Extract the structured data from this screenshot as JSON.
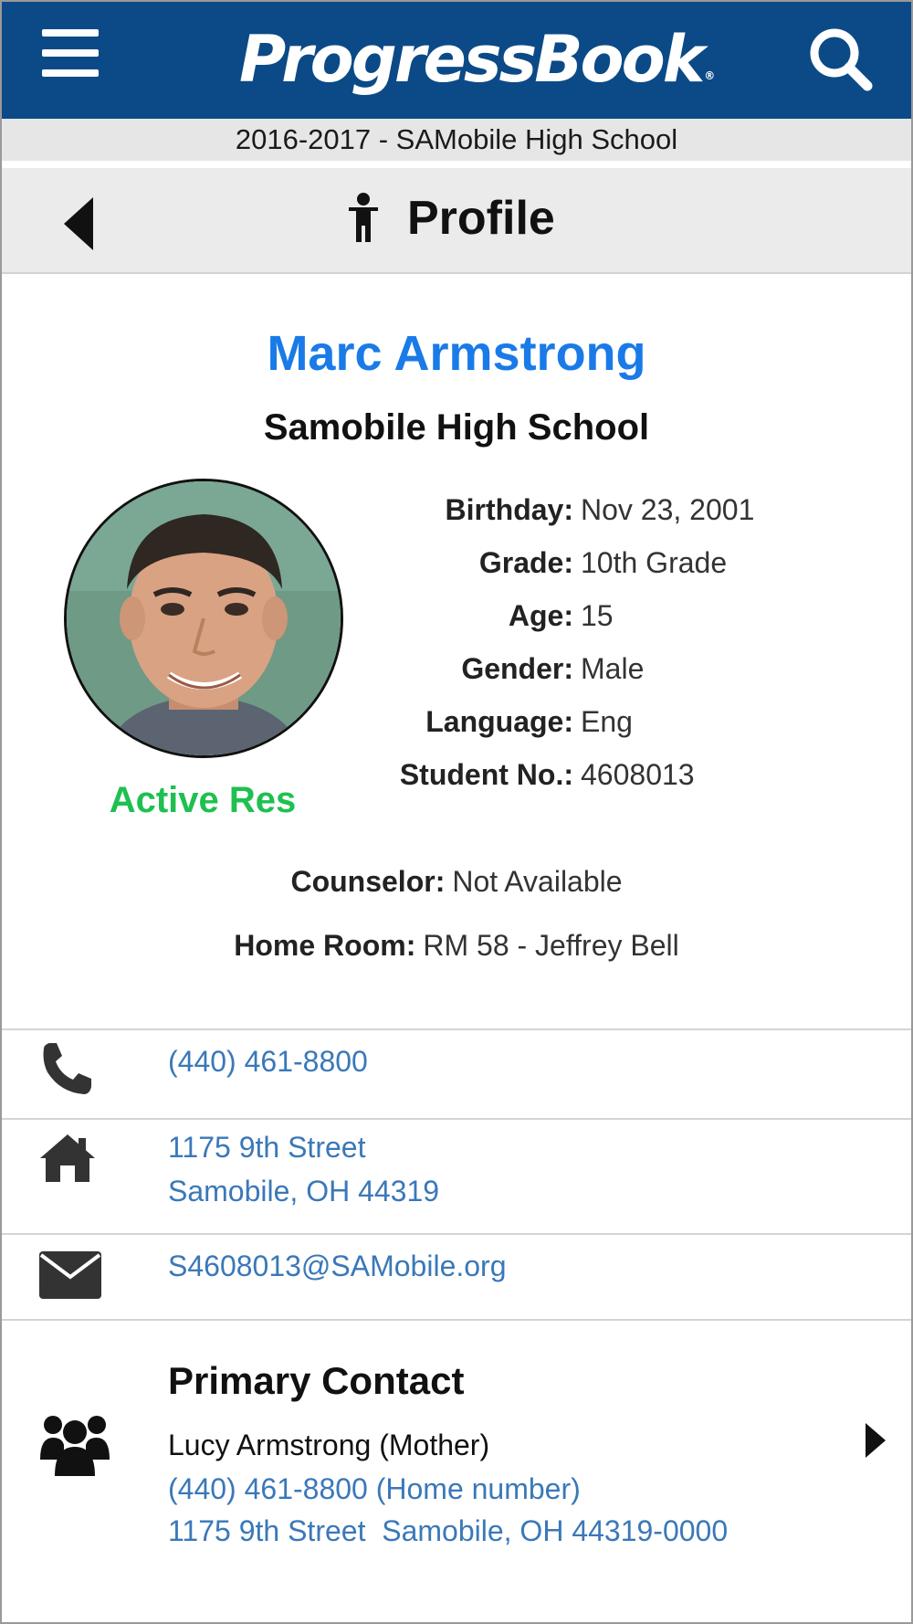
{
  "app": {
    "brand": "ProgressBook",
    "brand_mark": "®",
    "school_year": "2016-2017 - SAMobile High School",
    "page_title": "Profile"
  },
  "icons": {
    "menu": "hamburger-menu-icon",
    "search": "search-icon",
    "back": "back-arrow-icon",
    "profile": "person-icon",
    "phone": "phone-icon",
    "home": "home-icon",
    "email": "envelope-icon",
    "contact": "group-icon",
    "contact_arrow": "chevron-right-icon"
  },
  "colors": {
    "header_bg": "#0b4a87",
    "name": "#1a7ae8",
    "status": "#1ec04f",
    "link": "#3a78b9"
  },
  "student": {
    "name": "Marc Armstrong",
    "school": "Samobile High School",
    "status": "Active Res",
    "details": [
      {
        "label": "Birthday:",
        "value": "Nov 23, 2001"
      },
      {
        "label": "Grade:",
        "value": "10th Grade"
      },
      {
        "label": "Age:",
        "value": "15"
      },
      {
        "label": "Gender:",
        "value": "Male"
      },
      {
        "label": "Language:",
        "value": "Eng"
      },
      {
        "label": "Student No.:",
        "value": "4608013"
      }
    ],
    "counselor": {
      "label": "Counselor:",
      "value": "Not Available"
    },
    "home_room": {
      "label": "Home Room:",
      "value": "RM 58 - Jeffrey Bell"
    }
  },
  "contact_info": {
    "phone": "(440) 461-8800",
    "address_line1": "1175 9th Street",
    "address_line2": "Samobile, OH 44319",
    "email": "S4608013@SAMobile.org"
  },
  "primary_contact": {
    "heading": "Primary Contact",
    "name": "Lucy Armstrong (Mother)",
    "phone": "(440) 461-8800 (Home number)",
    "address": "1175 9th Street  Samobile, OH 44319-0000"
  }
}
